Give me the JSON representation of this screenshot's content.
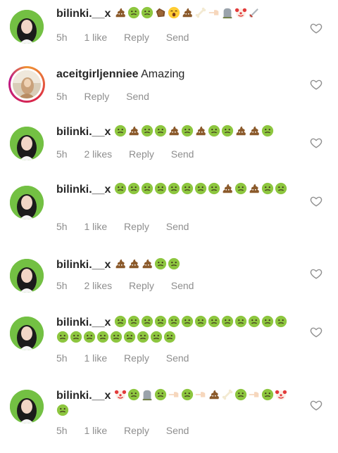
{
  "comments": [
    {
      "username": "bilinki.__x",
      "text": "",
      "emojis": [
        "poop-emoji",
        "nauseated-face-emoji",
        "nauseated-face-emoji",
        "coffin-emoji",
        "yawning-face-emoji",
        "poop-emoji",
        "bone-emoji",
        "pointing-left-hand-emoji",
        "headstone-emoji",
        "clown-face-emoji",
        "dagger-emoji"
      ],
      "time": "5h",
      "likes": "1 like",
      "reply": "Reply",
      "send": "Send"
    },
    {
      "username": "aceitgirljenniee",
      "text": "Amazing",
      "emojis": [],
      "time": "5h",
      "likes": "",
      "reply": "Reply",
      "send": "Send"
    },
    {
      "username": "bilinki.__x",
      "text": "",
      "emojis": [
        "nauseated-face-emoji",
        "poop-emoji",
        "nauseated-face-emoji",
        "nauseated-face-emoji",
        "poop-emoji",
        "nauseated-face-emoji",
        "poop-emoji",
        "nauseated-face-emoji",
        "nauseated-face-emoji",
        "poop-emoji",
        "poop-emoji",
        "nauseated-face-emoji"
      ],
      "time": "5h",
      "likes": "2 likes",
      "reply": "Reply",
      "send": "Send"
    },
    {
      "username": "bilinki.__x",
      "text": "",
      "emojis": [
        "nauseated-face-emoji",
        "nauseated-face-emoji",
        "nauseated-face-emoji",
        "nauseated-face-emoji",
        "nauseated-face-emoji",
        "nauseated-face-emoji",
        "nauseated-face-emoji",
        "nauseated-face-emoji",
        "poop-emoji",
        "nauseated-face-emoji",
        "poop-emoji",
        "nauseated-face-emoji",
        "nauseated-face-emoji"
      ],
      "time": "5h",
      "likes": "1 like",
      "reply": "Reply",
      "send": "Send"
    },
    {
      "username": "bilinki.__x",
      "text": "",
      "emojis": [
        "poop-emoji",
        "poop-emoji",
        "poop-emoji",
        "nauseated-face-emoji",
        "nauseated-face-emoji"
      ],
      "time": "5h",
      "likes": "2 likes",
      "reply": "Reply",
      "send": "Send"
    },
    {
      "username": "bilinki.__x",
      "text": "",
      "emojis": [
        "nauseated-face-emoji",
        "nauseated-face-emoji",
        "nauseated-face-emoji",
        "nauseated-face-emoji",
        "nauseated-face-emoji",
        "nauseated-face-emoji",
        "nauseated-face-emoji",
        "nauseated-face-emoji",
        "nauseated-face-emoji",
        "nauseated-face-emoji",
        "nauseated-face-emoji",
        "nauseated-face-emoji",
        "nauseated-face-emoji",
        "nauseated-face-emoji",
        "nauseated-face-emoji",
        "nauseated-face-emoji",
        "nauseated-face-emoji",
        "nauseated-face-emoji",
        "nauseated-face-emoji",
        "nauseated-face-emoji",
        "nauseated-face-emoji",
        "nauseated-face-emoji"
      ],
      "time": "5h",
      "likes": "1 like",
      "reply": "Reply",
      "send": "Send"
    },
    {
      "username": "bilinki.__x",
      "text": "",
      "emojis": [
        "clown-face-emoji",
        "nauseated-face-emoji",
        "headstone-emoji",
        "nauseated-face-emoji",
        "pointing-left-hand-emoji",
        "nauseated-face-emoji",
        "pointing-left-hand-emoji",
        "poop-emoji",
        "bone-emoji",
        "nauseated-face-emoji",
        "pointing-left-hand-emoji",
        "nauseated-face-emoji",
        "clown-face-emoji",
        "nauseated-face-emoji"
      ],
      "time": "5h",
      "likes": "1 like",
      "reply": "Reply",
      "send": "Send"
    }
  ],
  "icons": {
    "heart": "heart-outline-icon"
  },
  "colors": {
    "username": "#262626",
    "meta": "#8e8e8e",
    "avatar_bg": "#73c043",
    "heart": "#8e8e8e"
  }
}
